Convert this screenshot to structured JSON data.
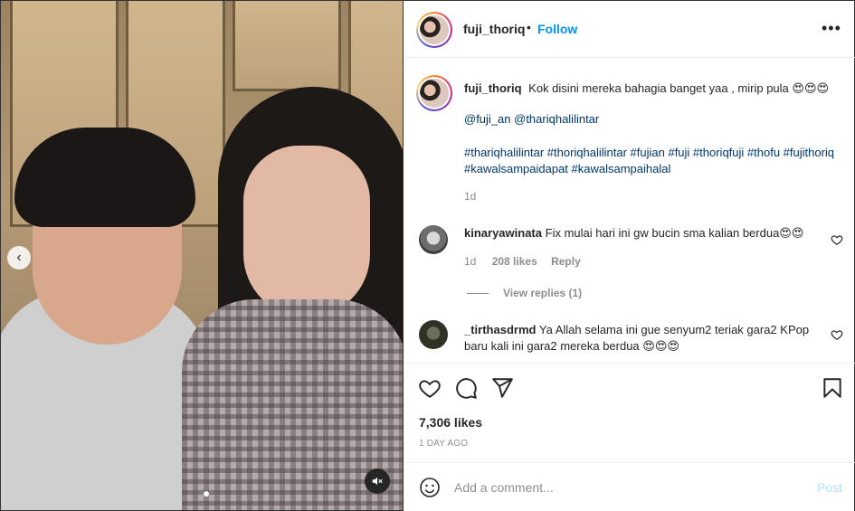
{
  "post": {
    "author": "fuji_thoriq",
    "separator": "•",
    "follow_label": "Follow",
    "more_label": "•••"
  },
  "caption": {
    "username": "fuji_thoriq",
    "text": "Kok disini mereka bahagia banget yaa , mirip pula 😍😍😍",
    "mentions": "@fuji_an @thariqhalilintar",
    "hashtags": "#thariqhalilintar #thoriqhalilintar #fujian #fuji #thoriqfuji #thofu #fujithoriq #kawalsampaidapat #kawalsampaihalal",
    "time": "1d"
  },
  "comments": [
    {
      "username": "kinaryawinata",
      "text": "Fix mulai hari ini gw bucin sma kalian berdua😍😍",
      "time": "1d",
      "likes": "208 likes",
      "reply_label": "Reply",
      "view_replies": "View replies (1)"
    },
    {
      "username": "_tirthasdrmd",
      "text": "Ya Allah selama ini gue senyum2 teriak gara2 KPop baru kali ini gara2 mereka berdua 😍😍😍"
    }
  ],
  "likes_count": "7,306 likes",
  "posted_ago": "1 DAY AGO",
  "add_comment": {
    "placeholder": "Add a comment...",
    "post_label": "Post"
  },
  "media": {
    "carousel_prev": "‹"
  },
  "icons": {
    "like": "heart-icon",
    "comment": "comment-icon",
    "share": "paper-plane-icon",
    "save": "bookmark-icon",
    "emoji": "smiley-icon",
    "mute": "muted-speaker-icon"
  },
  "colors": {
    "follow": "#0095f6",
    "link": "#00376b",
    "muted": "#8e8e8e",
    "post_disabled": "#b2dffc"
  }
}
